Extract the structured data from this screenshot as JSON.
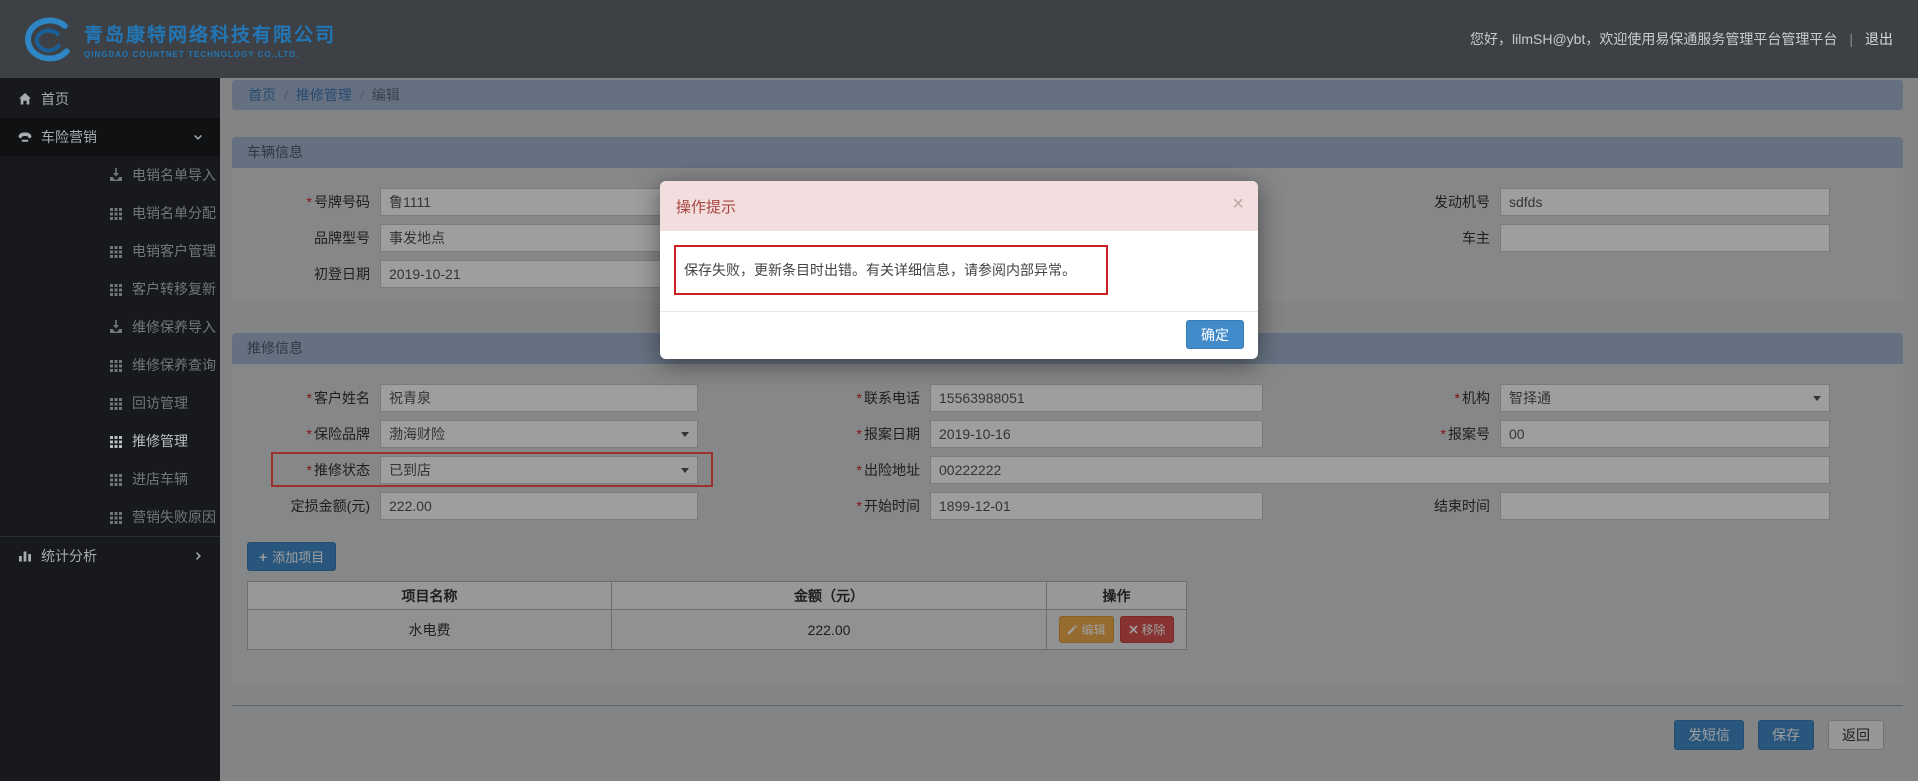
{
  "required_mark": "*",
  "header": {
    "brand_cn": "青岛康特网络科技有限公司",
    "brand_en": "QINGDAO COUNTNET TECHNOLOGY CO.,LTD.",
    "greeting": "您好，lilmSH@ybt，欢迎使用易保通服务管理平台管理平台",
    "divider": "|",
    "logout": "退出"
  },
  "sidebar": {
    "items": [
      {
        "label": "首页",
        "icon": "home"
      },
      {
        "label": "车险营销",
        "icon": "phone"
      },
      {
        "label": "电销名单导入",
        "icon": "import"
      },
      {
        "label": "电销名单分配",
        "icon": "grid"
      },
      {
        "label": "电销客户管理",
        "icon": "grid"
      },
      {
        "label": "客户转移复新",
        "icon": "grid"
      },
      {
        "label": "维修保养导入",
        "icon": "import"
      },
      {
        "label": "维修保养查询",
        "icon": "grid"
      },
      {
        "label": "回访管理",
        "icon": "grid"
      },
      {
        "label": "推修管理",
        "icon": "grid",
        "active": true
      },
      {
        "label": "进店车辆",
        "icon": "grid"
      },
      {
        "label": "营销失败原因",
        "icon": "grid"
      },
      {
        "label": "统计分析",
        "icon": "chart"
      }
    ]
  },
  "breadcrumb": {
    "home": "首页",
    "section": "推修管理",
    "current": "编辑",
    "separator": "/"
  },
  "vehicle_panel": {
    "title": "车辆信息",
    "fields": {
      "plate": {
        "label": "号牌号码",
        "value": "鲁1111"
      },
      "engine_no": {
        "label": "发动机号",
        "value": "sdfds"
      },
      "brand_model": {
        "label": "品牌型号",
        "value": "事发地点"
      },
      "owner": {
        "label": "车主",
        "value": ""
      },
      "first_reg": {
        "label": "初登日期",
        "value": "2019-10-21"
      }
    }
  },
  "repair_panel": {
    "title": "推修信息",
    "fields": {
      "customer_name": {
        "label": "客户姓名",
        "value": "祝青泉"
      },
      "phone": {
        "label": "联系电话",
        "value": "15563988051"
      },
      "org": {
        "label": "机构",
        "value": "智择通"
      },
      "insurance_brand": {
        "label": "保险品牌",
        "value": "渤海财险"
      },
      "report_date": {
        "label": "报案日期",
        "value": "2019-10-16"
      },
      "report_no": {
        "label": "报案号",
        "value": "00"
      },
      "repair_status": {
        "label": "推修状态",
        "value": "已到店"
      },
      "accident_addr": {
        "label": "出险地址",
        "value": "00222222"
      },
      "loss_amount": {
        "label": "定损金额(元)",
        "value": "222.00"
      },
      "start_time": {
        "label": "开始时间",
        "value": "1899-12-01"
      },
      "end_time": {
        "label": "结束时间",
        "value": ""
      }
    }
  },
  "add_item": {
    "label": "添加项目",
    "plus_icon": "+"
  },
  "items_table": {
    "headers": [
      "项目名称",
      "金额（元）",
      "操作"
    ],
    "row": {
      "name": "水电费",
      "amount": "222.00"
    },
    "edit_label": "编辑",
    "remove_label": "移除"
  },
  "footer_buttons": {
    "sms": "发短信",
    "save": "保存",
    "back": "返回"
  },
  "modal": {
    "title": "操作提示",
    "message": "保存失败，更新条目时出错。有关详细信息，请参阅内部异常。",
    "ok": "确定",
    "close": "×"
  },
  "colors": {
    "accent": "#428bca",
    "danger": "#d9534f",
    "warning": "#f0ad4e",
    "modal_header_bg": "#f2dede",
    "modal_header_text": "#a94442",
    "highlight_red": "#ff4d4d"
  }
}
